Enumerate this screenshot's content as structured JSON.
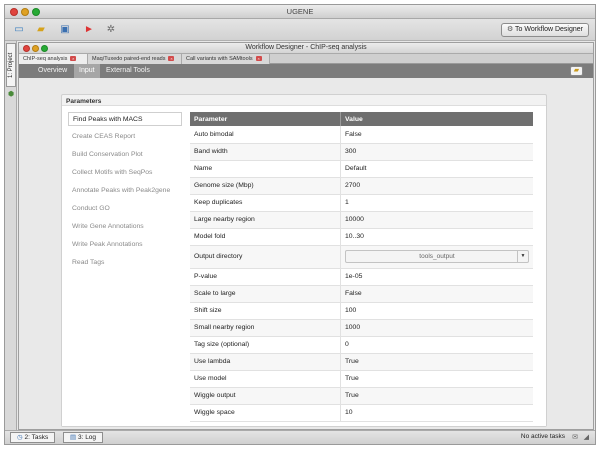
{
  "app": {
    "title": "UGENE"
  },
  "toolbar": {
    "icons": [
      "new-document-icon",
      "open-folder-icon",
      "save-icon",
      "run-icon",
      "settings-icon"
    ],
    "workflow_button": "To Workflow Designer"
  },
  "left_strip": {
    "project_tab": "1: Project"
  },
  "inner_window": {
    "title": "Workflow Designer - ChIP-seq analysis",
    "doc_tabs": [
      {
        "label": "ChIP-seq analysis"
      },
      {
        "label": "Maq/Tuxedo paired-end reads"
      },
      {
        "label": "Call variants with SAMtools"
      }
    ],
    "sub_tabs": [
      "Overview",
      "Input",
      "External Tools"
    ]
  },
  "panel": {
    "title": "Parameters",
    "steps": [
      "Find Peaks with MACS",
      "Create CEAS Report",
      "Build Conservation Plot",
      "Collect Motifs with SeqPos",
      "Annotate Peaks with Peak2gene",
      "Conduct GO",
      "Write Gene Annotations",
      "Write Peak Annotations",
      "Read Tags"
    ],
    "table": {
      "headers": [
        "Parameter",
        "Value"
      ],
      "rows": [
        [
          "Auto bimodal",
          "False"
        ],
        [
          "Band width",
          "300"
        ],
        [
          "Name",
          "Default"
        ],
        [
          "Genome size (Mbp)",
          "2700"
        ],
        [
          "Keep duplicates",
          "1"
        ],
        [
          "Large nearby region",
          "10000"
        ],
        [
          "Model fold",
          "10..30"
        ],
        [
          "Output directory",
          "tools_output"
        ],
        [
          "P-value",
          "1e-05"
        ],
        [
          "Scale to large",
          "False"
        ],
        [
          "Shift size",
          "100"
        ],
        [
          "Small nearby region",
          "1000"
        ],
        [
          "Tag size (optional)",
          "0"
        ],
        [
          "Use lambda",
          "True"
        ],
        [
          "Use model",
          "True"
        ],
        [
          "Wiggle output",
          "True"
        ],
        [
          "Wiggle space",
          "10"
        ]
      ]
    }
  },
  "statusbar": {
    "tasks_button": "2: Tasks",
    "log_button": "3: Log",
    "status_text": "No active tasks"
  }
}
